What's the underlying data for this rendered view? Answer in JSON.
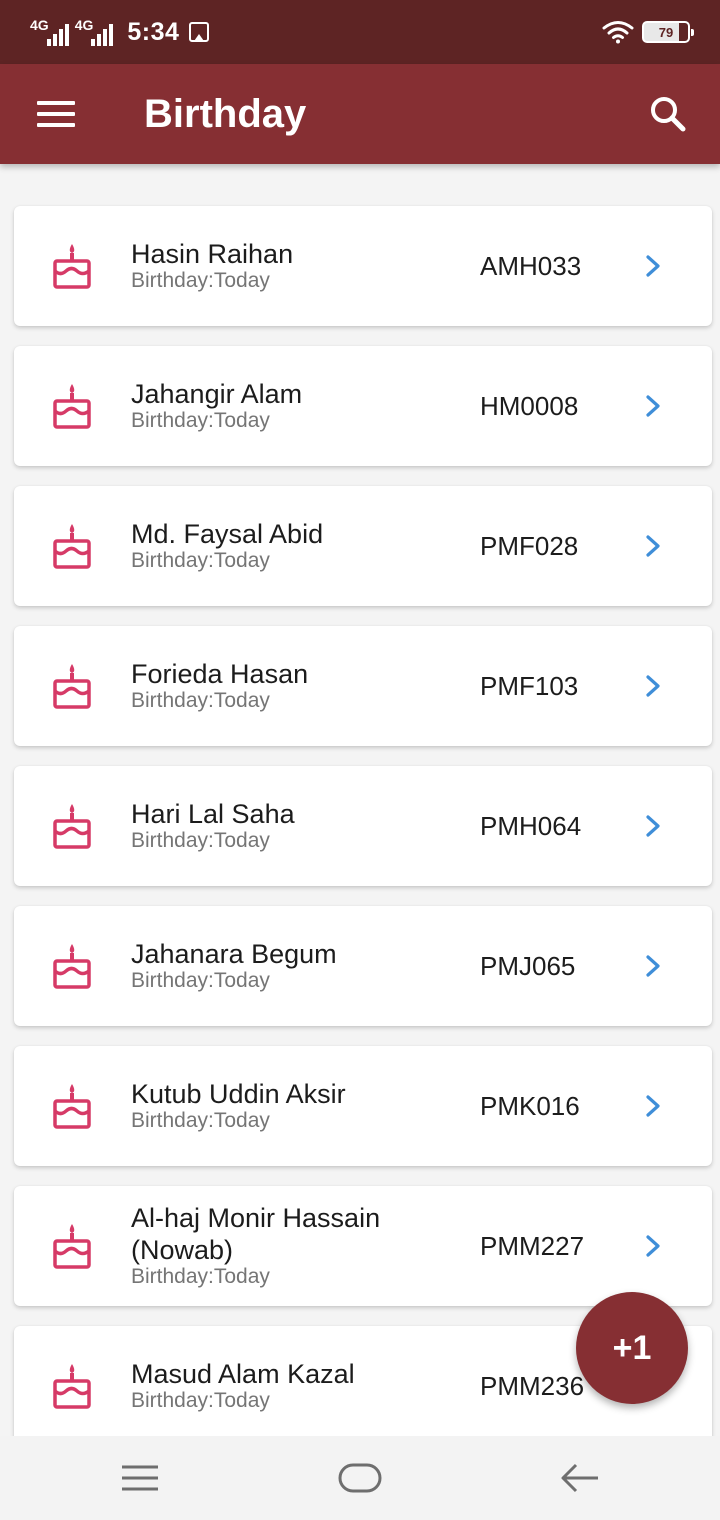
{
  "status_bar": {
    "network_1": "4G",
    "network_2": "4G",
    "time": "5:34",
    "battery": "79",
    "icons": [
      "signal-icon",
      "signal-icon",
      "gallery-icon",
      "wifi-icon",
      "battery-icon"
    ]
  },
  "app_bar": {
    "title": "Birthday",
    "menu_icon": "hamburger-menu-icon",
    "search_icon": "search-icon"
  },
  "list": [
    {
      "name": "Hasin Raihan",
      "subtitle": "Birthday:Today",
      "code": "AMH033"
    },
    {
      "name": "Jahangir Alam",
      "subtitle": "Birthday:Today",
      "code": "HM0008"
    },
    {
      "name": "Md. Faysal Abid",
      "subtitle": "Birthday:Today",
      "code": "PMF028"
    },
    {
      "name": "Forieda Hasan",
      "subtitle": "Birthday:Today",
      "code": "PMF103"
    },
    {
      "name": "Hari Lal Saha",
      "subtitle": "Birthday:Today",
      "code": "PMH064"
    },
    {
      "name": "Jahanara Begum",
      "subtitle": "Birthday:Today",
      "code": "PMJ065"
    },
    {
      "name": "Kutub Uddin Aksir",
      "subtitle": "Birthday:Today",
      "code": "PMK016"
    },
    {
      "name": "Al-haj Monir Hassain (Nowab)",
      "subtitle": "Birthday:Today",
      "code": "PMM227"
    },
    {
      "name": "Masud Alam Kazal",
      "subtitle": "Birthday:Today",
      "code": "PMM236"
    }
  ],
  "fab": {
    "label": "+1"
  },
  "nav_bar": {
    "icons": [
      "recents-icon",
      "home-icon",
      "back-icon"
    ]
  },
  "colors": {
    "status_bar": "#5e2424",
    "app_bar": "#862f33",
    "cake": "#d63a67",
    "chevron": "#3f8ed8",
    "fab": "#862f33"
  }
}
